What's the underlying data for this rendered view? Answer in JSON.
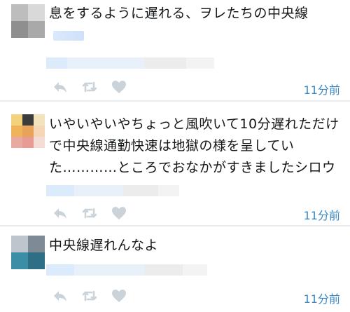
{
  "tweets": [
    {
      "text": "息をするように遅れる、ヲレたちの中央線",
      "time": "11分前"
    },
    {
      "text": "いやいやいやちょっと風吹いて10分遅れただけで中央線通勤快速は地獄の様を呈していた…………ところでおなかがすきましたシロウ",
      "time": "11分前"
    },
    {
      "text": "中央線遅れんなよ",
      "time": "11分前"
    }
  ],
  "icons": {
    "reply": "reply-icon",
    "retweet": "retweet-icon",
    "like": "heart-icon"
  },
  "colors": {
    "timestamp": "#3b88c3",
    "icon": "#cbd3da",
    "divider": "#e6ecf0"
  }
}
